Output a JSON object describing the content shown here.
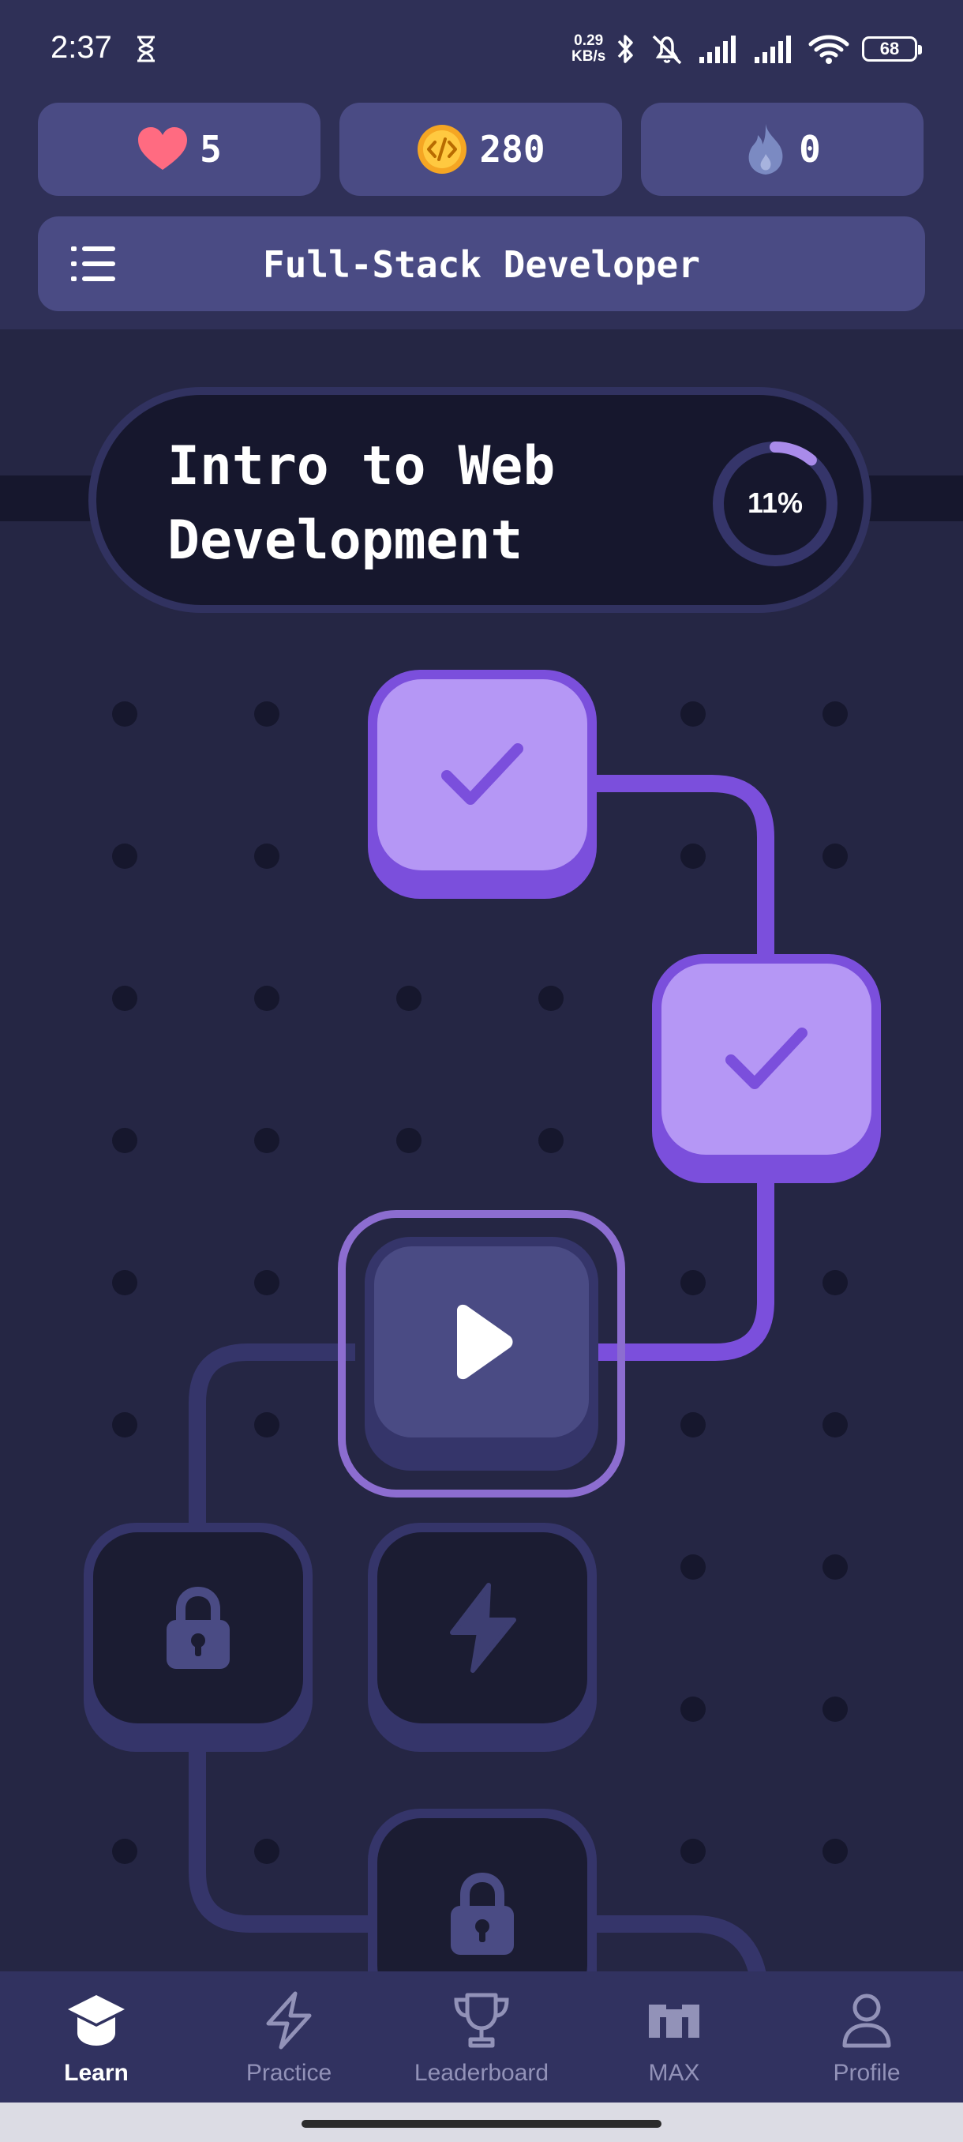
{
  "status_bar": {
    "time": "2:37",
    "net_speed_value": "0.29",
    "net_speed_unit": "KB/s",
    "battery": "68"
  },
  "stats": {
    "hearts": "5",
    "coins": "280",
    "streak": "0"
  },
  "course": {
    "title": "Full-Stack Developer"
  },
  "unit": {
    "title_line1": "Intro to Web",
    "title_line2": "Development",
    "progress_label": "11%",
    "progress_fraction": 0.11
  },
  "path_nodes": [
    {
      "state": "completed",
      "icon": "check-icon"
    },
    {
      "state": "completed",
      "icon": "check-icon"
    },
    {
      "state": "current",
      "icon": "play-icon"
    },
    {
      "state": "locked",
      "icon": "lock-icon"
    },
    {
      "state": "locked",
      "icon": "bolt-icon"
    },
    {
      "state": "locked",
      "icon": "lock-icon"
    }
  ],
  "colors": {
    "background": "#252644",
    "header": "#2f3057",
    "accent": "#7b4fdc",
    "accent_light": "#b597f5",
    "heart": "#ff6b81",
    "coin": "#f5a623"
  },
  "bottom_nav": {
    "items": [
      {
        "label": "Learn",
        "icon": "graduation-cap-icon",
        "active": true
      },
      {
        "label": "Practice",
        "icon": "bolt-icon",
        "active": false
      },
      {
        "label": "Leaderboard",
        "icon": "trophy-icon",
        "active": false
      },
      {
        "label": "MAX",
        "icon": "max-logo-icon",
        "active": false
      },
      {
        "label": "Profile",
        "icon": "person-icon",
        "active": false
      }
    ]
  }
}
